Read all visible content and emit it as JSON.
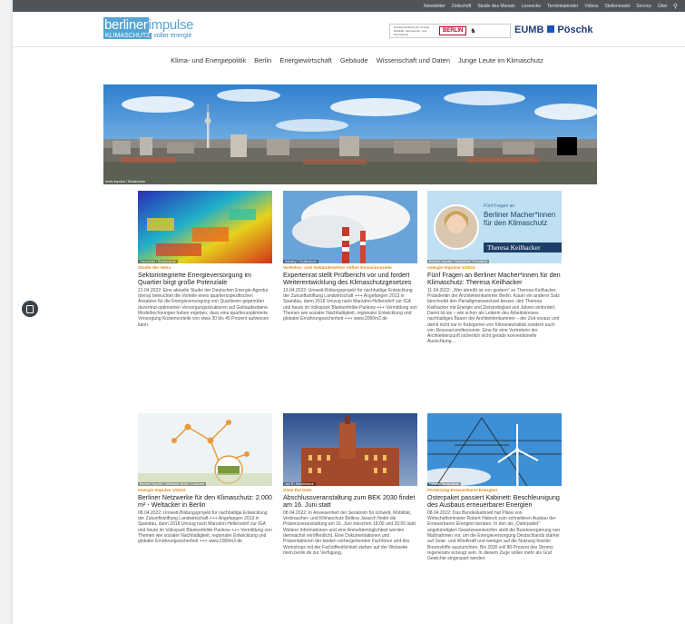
{
  "topbar": {
    "links": [
      "Newsletter",
      "Zeitschrift",
      "Studio des Monats",
      "Leseecke",
      "Terminkalender",
      "Videos",
      "Stellenmarkt",
      "Service",
      "Über"
    ],
    "search_icon": "search-icon"
  },
  "logo": {
    "line1a": "berliner",
    "line1b": "impulse",
    "line2a": "KLIMASCHUTZ",
    "line2b": "voller energie"
  },
  "sponsor": {
    "small": "Senatsverwaltung für Umwelt, Mobilität, Verbraucher- und Klimaschutz",
    "berlin": "BERLIN"
  },
  "eumb": {
    "left": "EUMB",
    "right": "Pöschk"
  },
  "nav": [
    "Klima- und Energiepolitik",
    "Berlin",
    "Energiewirtschaft",
    "Gebäude",
    "Wissenschaft und Daten",
    "Junge Leute im Klimaschutz"
  ],
  "hero": {
    "caption": "berlin-impulse / Shutterstock"
  },
  "cards": [
    {
      "caption": "Fraunhofer / Shutterstock",
      "category": "Studie der dena",
      "title": "Sektorintegrierte Energieversorgung im Quartier birgt große Potenziale",
      "text": "21.04.2022: Eine aktuelle Studie der Deutschen Energie-Agentur (dena) beleuchtet die Vorteile eines quartiersspezifischen Ansatzes für die Energieversorgung von Quartieren gegenüber dezentral-optimierten Versorgungsstrukturen auf Gebäudeebene. Modellrechnungen haben ergeben, dass eine quartiersoptimierte Versorgung Kostenvorteile von etwa 30 bis 45 Prozent aufweisen kann."
    },
    {
      "caption": "Industry / Shutterstock",
      "category": "Verkehrs- und Gebäudesektor reißen Emissionsziele",
      "title": "Expertenrat stellt Prüfbericht vor und fordert Weiterentwicklung des Klimaschutzgesetzes",
      "text": "13.04.2022: Umwelt-Bildungsprojekt für nachhaltige Entwicklung der Zukunftsstiftung Landwirtschaft +++ Angefangen 2013 in Spandau, dann 2018 Umzug nach Marzahn-Hellersdorf zur IGA und heute im Volkspark Blankenfelde-Pankow +++ Vermittlung von Themen wie sozialer Nachhaltigkeit, regionaler Entwicklung und globaler Ernährungssicherheit +++ www.2000m2.de"
    },
    {
      "caption": "Berliner Impulse / Sebastiane Thomasina",
      "category": "energie Impulse 1/2022",
      "title": "Fünf Fragen an Berliner Macher*innen für den Klimaschutz: Theresa Keilhacker",
      "text": "11.04.2022: „Wer abreißt ist von gestern“ so Theresa Keilhacker, Präsidentin der Architektenkammer Berlin. Kaum ein anderer Satz beschreibt den Paradigmenwechsel besser, den Theresa Keilhacker mit Energie und Zielstrebigkeit seit Jahren einfordert. Damit ist sie – wie schon als Leiterin des Arbeitskreises nachhaltiges Bauen der Architektenkammer – der Zeit voraus und damit nicht nur in Kategorien von Klimaneutralität sondern auch von Ressourcenökonomie. Eine für eine Vertreterin der Architektenzunft sicherlich nicht gerade konventionelle Ausrichtung…",
      "overlay": {
        "small": "Fünf Fragen an",
        "big": "Berliner Macher*innen für den Klimaschutz",
        "name": "Theresa Keilhacker"
      }
    },
    {
      "caption": "Berliner Impulse / Weltacker Berlin / Lorenzen",
      "category": "energie Impulse 1/2022",
      "title": "Berliner Netzwerke für den Klimaschutz: 2.000 m² - Weltacker in Berlin",
      "text": "08.04.2022: Umwelt-Bildungsprojekt für nachhaltige Entwicklung der Zukunftsstiftung Landwirtschaft +++ Angefangen 2013 in Spandau, dann 2018 Umzug nach Marzahn-Hellersdorf zur IGA und heute im Volkspark Blankenfelde-Pankow +++ Vermittlung von Themen wie sozialer Nachhaltigkeit, regionaler Entwicklung und globaler Ernährungssicherheit +++ www.2000m2.de"
    },
    {
      "caption": "Jan R / Shutterstock",
      "category": "Save the Date",
      "title": "Abschlussveranstaltung zum BEK 2030 findet am 16. Juni statt",
      "text": "08.04.2022: In Anwesenheit der Senatorin für Umwelt, Mobilität, Verbraucher- und Klimaschutz Bettina Jarasch findet die Präsenzveranstaltung am 16. Juni zwischen 18:00 und 20:00 statt. Weitere Informationen und eine Anmeldemöglichkeit werden demnächst veröffentlicht. Eine Dokumentationen und Präsentationen der beiden vorhergehenden Fachforen und des Workshops mit der Fachöffentlichkeit stehen auf der Webseite mein.berlin.de zur Verfügung."
    },
    {
      "caption": "Farkas / Shutterstock",
      "category": "Förderung Erneuerbarer Energien",
      "title": "Osterpaket passiert Kabinett: Beschleunigung des Ausbaus erneuerbarer Energien",
      "text": "08.04.2022: Das Bundeskabinett hat Pläne von Wirtschaftsminister Robert Habeck zum schnelleren Ausbau der Erneuerbaren Energien beraten. In den als „Osterpaket“ angekündigten Gesetzesentwürfen stellt die Bundesregierung nun Maßnahmen vor, um die Energieversorgung Deutschlands stärker auf Solar- und Windkraft und weniger auf die Nutzung fossiler Brennstoffe auszurichten. Bis 2030 soll 80 Prozent des Stroms regenerativ erzeugt sein. In diesem Zuge sollen mehr als Graf Gewichte eingespart werden."
    }
  ],
  "colors": {
    "accent_blue": "#56a4d4",
    "category_orange": "#e08a1a",
    "topbar": "#4f5458"
  }
}
